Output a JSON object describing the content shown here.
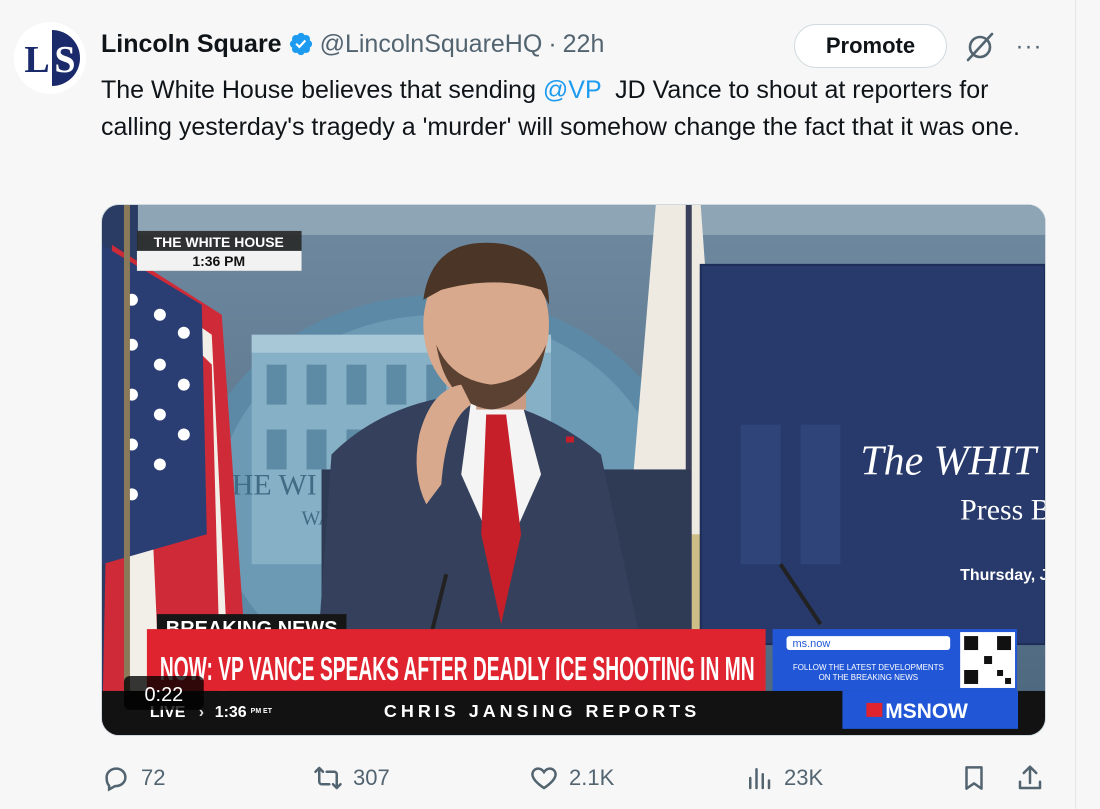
{
  "tweet": {
    "author_name": "Lincoln Square",
    "handle": "@LincolnSquareHQ",
    "separator": "·",
    "time": "22h",
    "avatar_text": "LS",
    "text_before": "The White House believes that sending ",
    "mention": "@VP",
    "text_after": "  JD Vance to shout at reporters for calling yesterday's tragedy a 'murder' will somehow change the fact that it was one.",
    "promote_label": "Promote",
    "more_label": "···"
  },
  "video": {
    "duration": "0:22",
    "location_tag": "THE WHITE HOUSE",
    "location_time": "1:36 PM",
    "breaking_label": "BREAKING NEWS",
    "headline": "NOW: VP VANCE SPEAKS AFTER DEADLY ICE SHOOTING IN MN",
    "live_label": "LIVE",
    "live_time": "1:36",
    "live_tz": "PM ET",
    "show_name": "CHRIS JANSING REPORTS",
    "site": "ms.now",
    "promo_text_1": "FOLLOW THE LATEST DEVELOPMENTS",
    "promo_text_2": "ON THE BREAKING NEWS",
    "network": "MSNOW",
    "backdrop_title_1": "The WHIT",
    "backdrop_title_2": "Press B",
    "backdrop_date": "Thursday, J",
    "seal_text_1": "HE WI",
    "seal_text_2": "WA"
  },
  "actions": {
    "replies": "72",
    "reposts": "307",
    "likes": "2.1K",
    "views": "23K"
  },
  "icons": [
    "verified-badge-icon",
    "grok-icon",
    "more-icon",
    "reply-icon",
    "repost-icon",
    "like-icon",
    "views-icon",
    "bookmark-icon",
    "share-icon"
  ],
  "colors": {
    "link": "#1d9bf0",
    "verified": "#1d9bf0",
    "text": "#0f1419",
    "muted": "#536471",
    "breaking_red": "#e0242f",
    "network_blue": "#2157d6"
  }
}
